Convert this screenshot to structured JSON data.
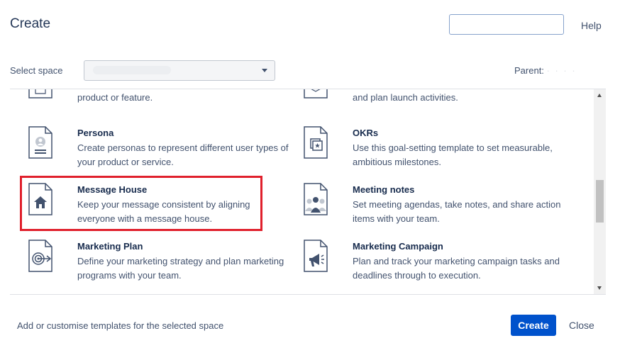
{
  "dialog": {
    "title": "Create",
    "help_label": "Help",
    "search_value": ""
  },
  "space": {
    "label": "Select space",
    "selected_value": "",
    "parent_label": "Parent:",
    "parent_value": "· · · ·"
  },
  "templates": [
    {
      "title": "",
      "description": "Define, track and scope requirements for your product or feature.",
      "icon": "document-icon"
    },
    {
      "title": "",
      "description": "Prepare your product launch, document strategy, and plan launch activities.",
      "icon": "box-icon"
    },
    {
      "title": "Persona",
      "description": "Create personas to represent different user types of your product or service.",
      "icon": "persona-icon"
    },
    {
      "title": "OKRs",
      "description": "Use this goal-setting template to set measurable, ambitious milestones.",
      "icon": "okr-icon"
    },
    {
      "title": "Message House",
      "description": "Keep your message consistent by aligning everyone with a message house.",
      "icon": "house-icon"
    },
    {
      "title": "Meeting notes",
      "description": "Set meeting agendas, take notes, and share action items with your team.",
      "icon": "meeting-icon"
    },
    {
      "title": "Marketing Plan",
      "description": "Define your marketing strategy and plan marketing programs with your team.",
      "icon": "target-icon"
    },
    {
      "title": "Marketing Campaign",
      "description": "Plan and track your marketing campaign tasks and deadlines through to execution.",
      "icon": "megaphone-icon"
    }
  ],
  "footer": {
    "customise_link": "Add or customise templates for the selected space",
    "create_label": "Create",
    "close_label": "Close"
  },
  "colors": {
    "primary": "#0052cc",
    "highlight": "#e0202c"
  }
}
